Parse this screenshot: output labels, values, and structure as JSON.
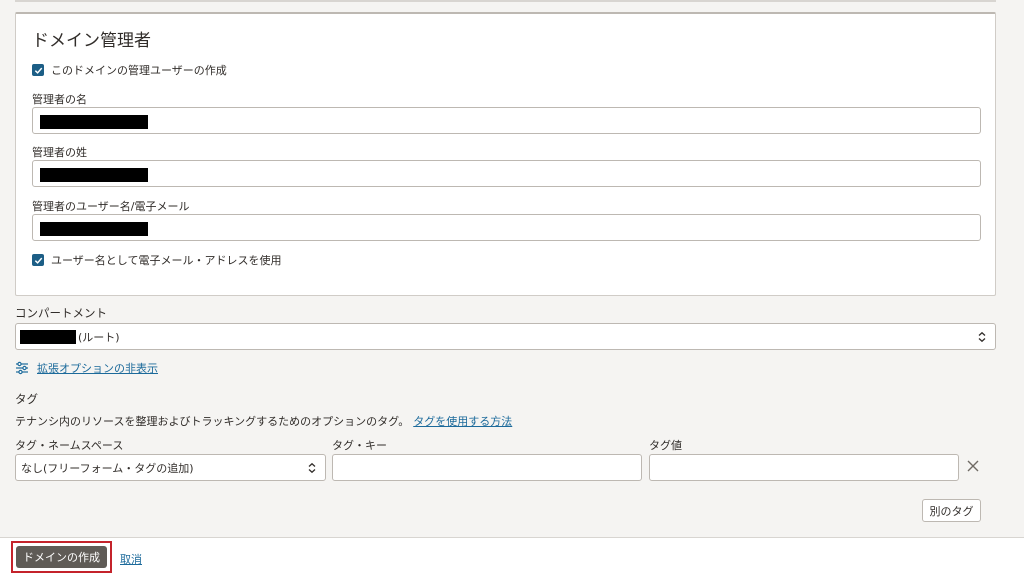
{
  "admin_panel": {
    "title": "ドメイン管理者",
    "create_admin_checkbox_label": "このドメインの管理ユーザーの作成",
    "first_name_label": "管理者の名",
    "last_name_label": "管理者の姓",
    "username_email_label": "管理者のユーザー名/電子メール",
    "use_email_checkbox_label": "ユーザー名として電子メール・アドレスを使用"
  },
  "compartment": {
    "label": "コンパートメント",
    "selected_suffix": "(ルート)"
  },
  "advanced_options_link": "拡張オプションの非表示",
  "tags": {
    "title": "タグ",
    "description": "テナンシ内のリソースを整理およびトラッキングするためのオプションのタグ。",
    "how_to_link": "タグを使用する方法",
    "namespace_label": "タグ・ネームスペース",
    "namespace_value": "なし(フリーフォーム・タグの追加)",
    "key_label": "タグ・キー",
    "value_label": "タグ値",
    "add_tag_button": "別のタグ"
  },
  "footer": {
    "create_button": "ドメインの作成",
    "cancel_link": "取消"
  },
  "colors": {
    "checkbox": "#1c5e86",
    "link": "#1c6a9b",
    "primary_button": "#5f5b56",
    "highlight_border": "#c4232b"
  }
}
